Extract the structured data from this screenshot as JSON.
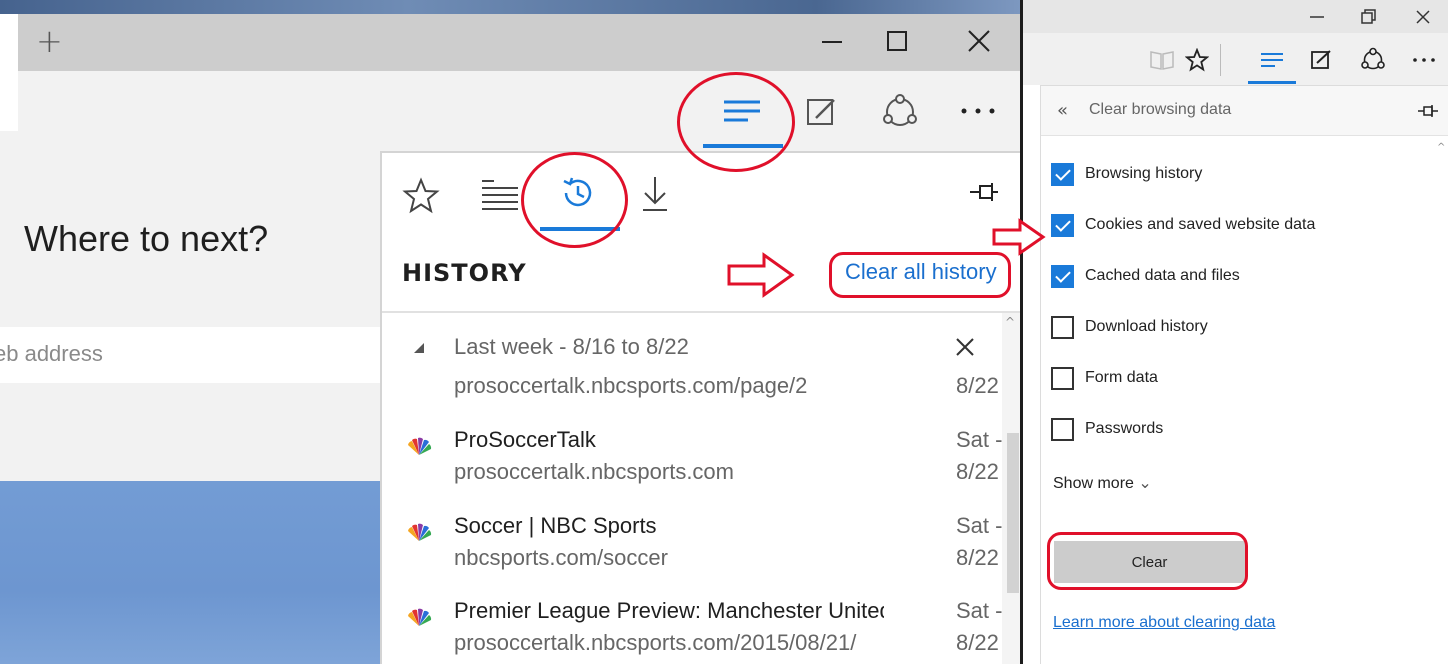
{
  "left": {
    "page_heading": "Where to next?",
    "address_placeholder": "eb address",
    "hub": {
      "title": "HISTORY",
      "clear_all_label": "Clear all history",
      "group": {
        "label": "Last week - 8/16 to 8/22"
      },
      "items": [
        {
          "title": "",
          "url": "prosoccertalk.nbcsports.com/page/2",
          "date1": "8/22",
          "date2": ""
        },
        {
          "title": "ProSoccerTalk",
          "url": "prosoccertalk.nbcsports.com",
          "date1": "Sat -",
          "date2": "8/22"
        },
        {
          "title": "Soccer | NBC Sports",
          "url": "nbcsports.com/soccer",
          "date1": "Sat -",
          "date2": "8/22"
        },
        {
          "title": "Premier League Preview: Manchester United",
          "url": "prosoccertalk.nbcsports.com/2015/08/21/",
          "date1": "Sat -",
          "date2": "8/22"
        }
      ]
    }
  },
  "right": {
    "panel_title": "Clear browsing data",
    "options": [
      {
        "label": "Browsing history",
        "checked": true
      },
      {
        "label": "Cookies and saved website data",
        "checked": true
      },
      {
        "label": "Cached data and files",
        "checked": true
      },
      {
        "label": "Download history",
        "checked": false
      },
      {
        "label": "Form data",
        "checked": false
      },
      {
        "label": "Passwords",
        "checked": false
      }
    ],
    "show_more_label": "Show more",
    "clear_button_label": "Clear",
    "learn_more_label": "Learn more about clearing data"
  },
  "colors": {
    "accent": "#1a7ad9",
    "annotation": "#e0102a",
    "link": "#1a6fce"
  }
}
